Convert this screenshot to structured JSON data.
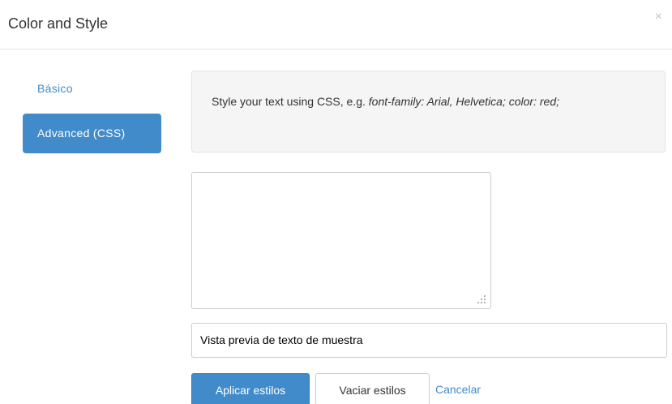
{
  "modal": {
    "title": "Color and Style",
    "close_symbol": "×"
  },
  "nav": {
    "items": [
      {
        "label": "Básico",
        "active": false
      },
      {
        "label": "Advanced (CSS)",
        "active": true
      }
    ]
  },
  "info": {
    "prefix": "Style your text using CSS, e.g. ",
    "example": "font-family: Arial, Helvetica; color: red;"
  },
  "css_input": {
    "value": ""
  },
  "preview": {
    "text": "Vista previa de texto de muestra"
  },
  "actions": {
    "apply_label": "Aplicar estilos",
    "clear_label": "Vaciar estilos",
    "cancel_label": "Cancelar"
  },
  "colors": {
    "accent": "#428bca",
    "well_bg": "#f5f5f5",
    "border": "#cccccc"
  },
  "icons": {
    "close": "close-icon",
    "resize": "resize-grip-icon"
  }
}
